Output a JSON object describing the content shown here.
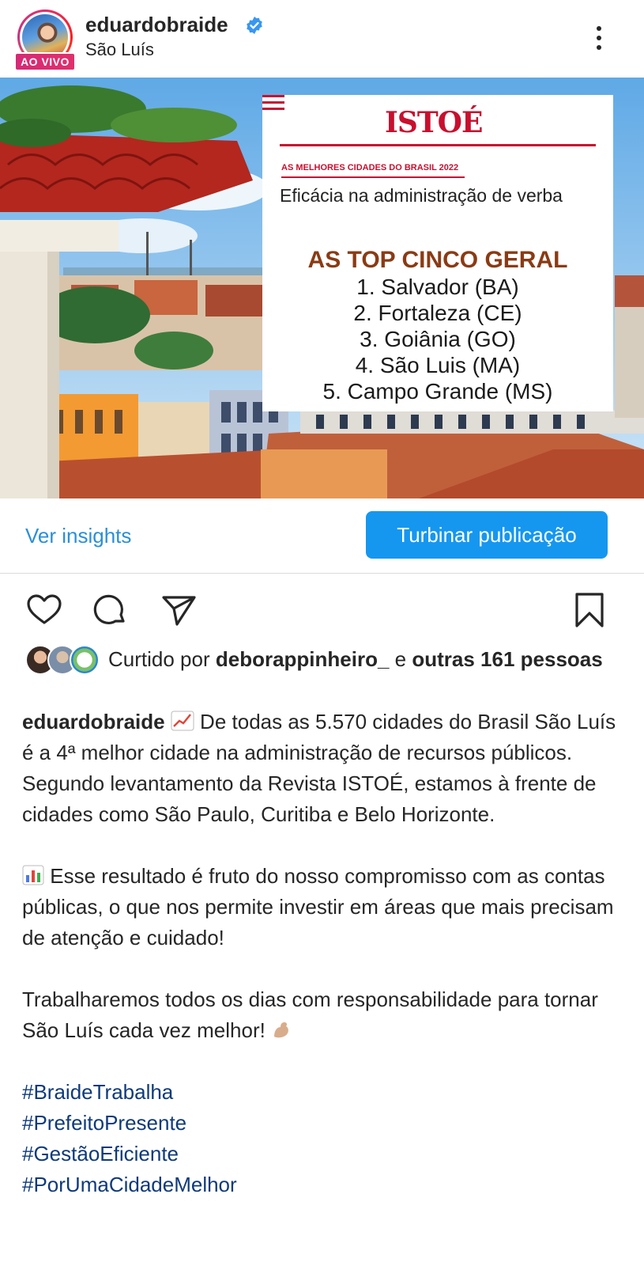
{
  "header": {
    "username": "eduardobraide",
    "location": "São Luís",
    "live_badge": "AO VIVO",
    "more_icon": "more-vertical-icon",
    "verified_icon": "verified-badge-icon",
    "verified_color": "#3897f0"
  },
  "post_image": {
    "card": {
      "logo": "ISTOÉ",
      "kicker": "AS MELHORES CIDADES DO BRASIL 2022",
      "subtitle": "Eficácia na administração de verba",
      "heading": "AS TOP CINCO GERAL",
      "ranking": [
        "1. Salvador (BA)",
        "2. Fortaleza (CE)",
        "3. Goiânia (GO)",
        "4. São Luis (MA)",
        "5. Campo Grande (MS)"
      ],
      "brand_color": "#c8102e",
      "heading_color": "#8a3b14"
    }
  },
  "insights": {
    "link_label": "Ver insights",
    "boost_label": "Turbinar publicação",
    "accent": "#1597f0"
  },
  "actions": {
    "like_icon": "heart-icon",
    "comment_icon": "comment-icon",
    "share_icon": "send-icon",
    "save_icon": "bookmark-icon"
  },
  "likes": {
    "prefix": "Curtido por",
    "user": "deborappinheiro_",
    "connector": "e",
    "others": "outras 161 pessoas"
  },
  "caption": {
    "username": "eduardobraide",
    "para1": " De todas as 5.570 cidades do Brasil São Luís é a 4ª melhor cidade na administração de recursos públicos. Segundo levantamento da Revista ISTOÉ, estamos à frente de cidades como São Paulo, Curitiba e Belo Horizonte.",
    "para2": " Esse resultado é fruto do nosso compromisso com as contas públicas, o que nos permite investir em áreas que mais precisam de atenção e cuidado!",
    "para3": "Trabalharemos todos os dias com responsabilidade para tornar São Luís cada vez melhor! ",
    "hashtags": [
      "#BraideTrabalha",
      "#PrefeitoPresente",
      "#GestãoEficiente",
      "#PorUmaCidadeMelhor"
    ],
    "hashtag_color": "#0f3a7a"
  }
}
